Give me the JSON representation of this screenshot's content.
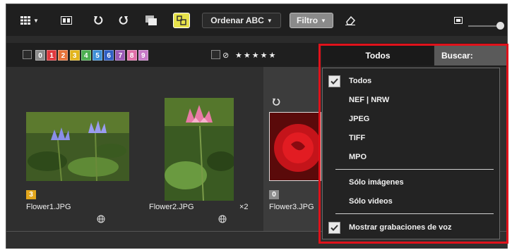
{
  "toolbar": {
    "sort_label": "Ordenar ABC",
    "filter_label": "Filtro"
  },
  "label_filter": {
    "labels": [
      {
        "text": "0",
        "color": "#8c8c8c"
      },
      {
        "text": "1",
        "color": "#e0393e"
      },
      {
        "text": "2",
        "color": "#e8733a"
      },
      {
        "text": "3",
        "color": "#e2b51c"
      },
      {
        "text": "4",
        "color": "#4caf50"
      },
      {
        "text": "5",
        "color": "#3d8fd6"
      },
      {
        "text": "6",
        "color": "#2f5fc4"
      },
      {
        "text": "7",
        "color": "#9b59b6"
      },
      {
        "text": "8",
        "color": "#e06fa8"
      },
      {
        "text": "9",
        "color": "#c879c8"
      }
    ]
  },
  "rating_filter": {
    "stars": "★★★★★"
  },
  "tabs": {
    "all_label": "Todos",
    "search_label": "Buscar:"
  },
  "thumbnails": [
    {
      "name": "Flower1.JPG",
      "badge": "3",
      "badge_color": "#e2a61c",
      "extra": ""
    },
    {
      "name": "Flower2.JPG",
      "badge": "",
      "badge_color": "",
      "extra": "×2"
    },
    {
      "name": "Flower3.JPG",
      "badge": "0",
      "badge_color": "#8c8c8c",
      "extra": ""
    }
  ],
  "filter_menu": {
    "items": [
      {
        "label": "Todos",
        "checked": true
      },
      {
        "label": "NEF | NRW",
        "checked": false
      },
      {
        "label": "JPEG",
        "checked": false
      },
      {
        "label": "TIFF",
        "checked": false
      },
      {
        "label": "MPO",
        "checked": false
      },
      {
        "label": "Sólo imágenes",
        "checked": false
      },
      {
        "label": "Sólo videos",
        "checked": false
      },
      {
        "label": "Mostrar grabaciones de voz",
        "checked": true
      }
    ]
  },
  "colors": {
    "highlight_box": "#e0121b",
    "active_toggle": "#e6e24a"
  }
}
